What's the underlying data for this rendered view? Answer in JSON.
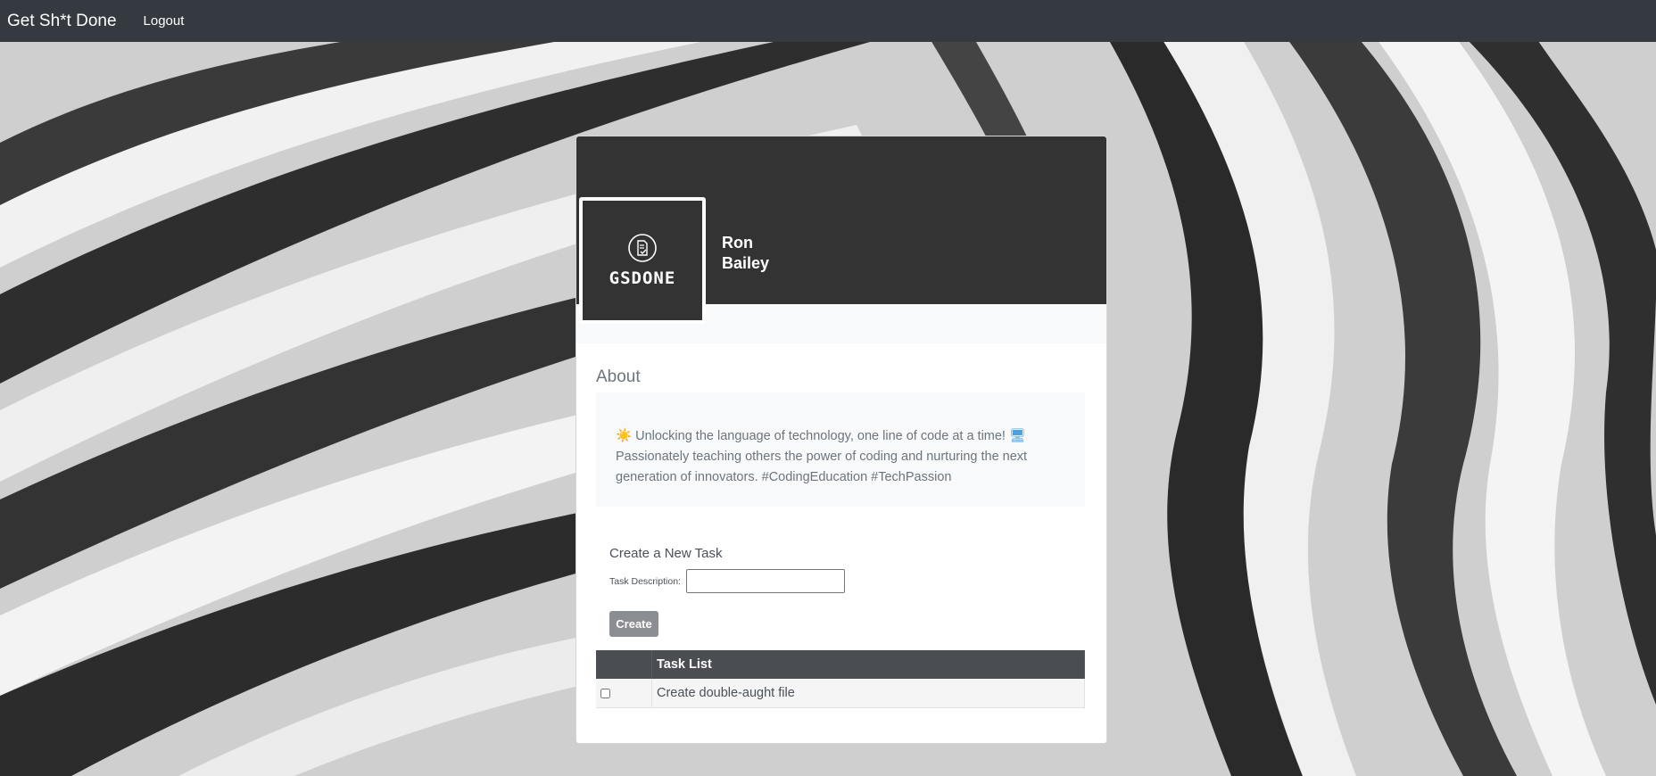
{
  "navbar": {
    "brand": "Get Sh*t Done",
    "logout_label": "Logout"
  },
  "profile": {
    "avatar_text": "GSDONE",
    "first_name": "Ron",
    "last_name": "Bailey",
    "about_title": "About",
    "about_sun_emoji": "☀️",
    "about_text_1": "Unlocking the language of technology, one line of code at a time!",
    "about_pc_emoji": "🖥",
    "about_text_2": "Passionately teaching others the power of coding and nurturing the next generation of innovators. #CodingEducation #TechPassion"
  },
  "task_form": {
    "title": "Create a New Task",
    "description_label": "Task Description:",
    "description_value": "",
    "create_label": "Create"
  },
  "task_table": {
    "header": "Task List",
    "rows": [
      {
        "checked": false,
        "description": "Create double-aught file"
      }
    ]
  },
  "colors": {
    "navbar": "#343a40",
    "card_header": "#333333",
    "button": "#8a8d91",
    "table_header": "#4a4e52"
  }
}
